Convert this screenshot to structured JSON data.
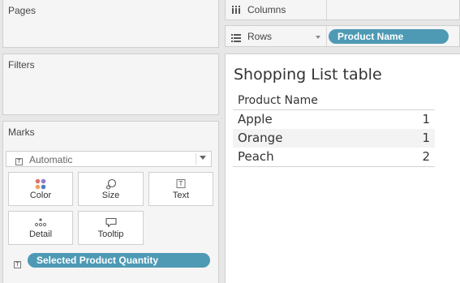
{
  "left_panel": {
    "pages_title": "Pages",
    "filters_title": "Filters",
    "marks_title": "Marks",
    "mark_type": "Automatic",
    "mark_cards": [
      {
        "label": "Color",
        "icon": "color-dots-icon"
      },
      {
        "label": "Size",
        "icon": "size-icon"
      },
      {
        "label": "Text",
        "icon": "text-box-icon"
      },
      {
        "label": "Detail",
        "icon": "detail-dots-icon"
      },
      {
        "label": "Tooltip",
        "icon": "tooltip-icon"
      }
    ],
    "mark_field": "Selected Product Quantity"
  },
  "shelves": {
    "columns_label": "Columns",
    "rows_label": "Rows",
    "rows_pill": "Product Name"
  },
  "view": {
    "title": "Shopping List table",
    "column_header": "Product Name",
    "rows": [
      {
        "name": "Apple",
        "qty": "1"
      },
      {
        "name": "Orange",
        "qty": "1"
      },
      {
        "name": "Peach",
        "qty": "2"
      }
    ]
  },
  "colors": {
    "pill": "#4e9ab5",
    "color_dots": [
      "#e0736b",
      "#4e7fc2",
      "#f0a35a",
      "#8f7cc7"
    ]
  }
}
